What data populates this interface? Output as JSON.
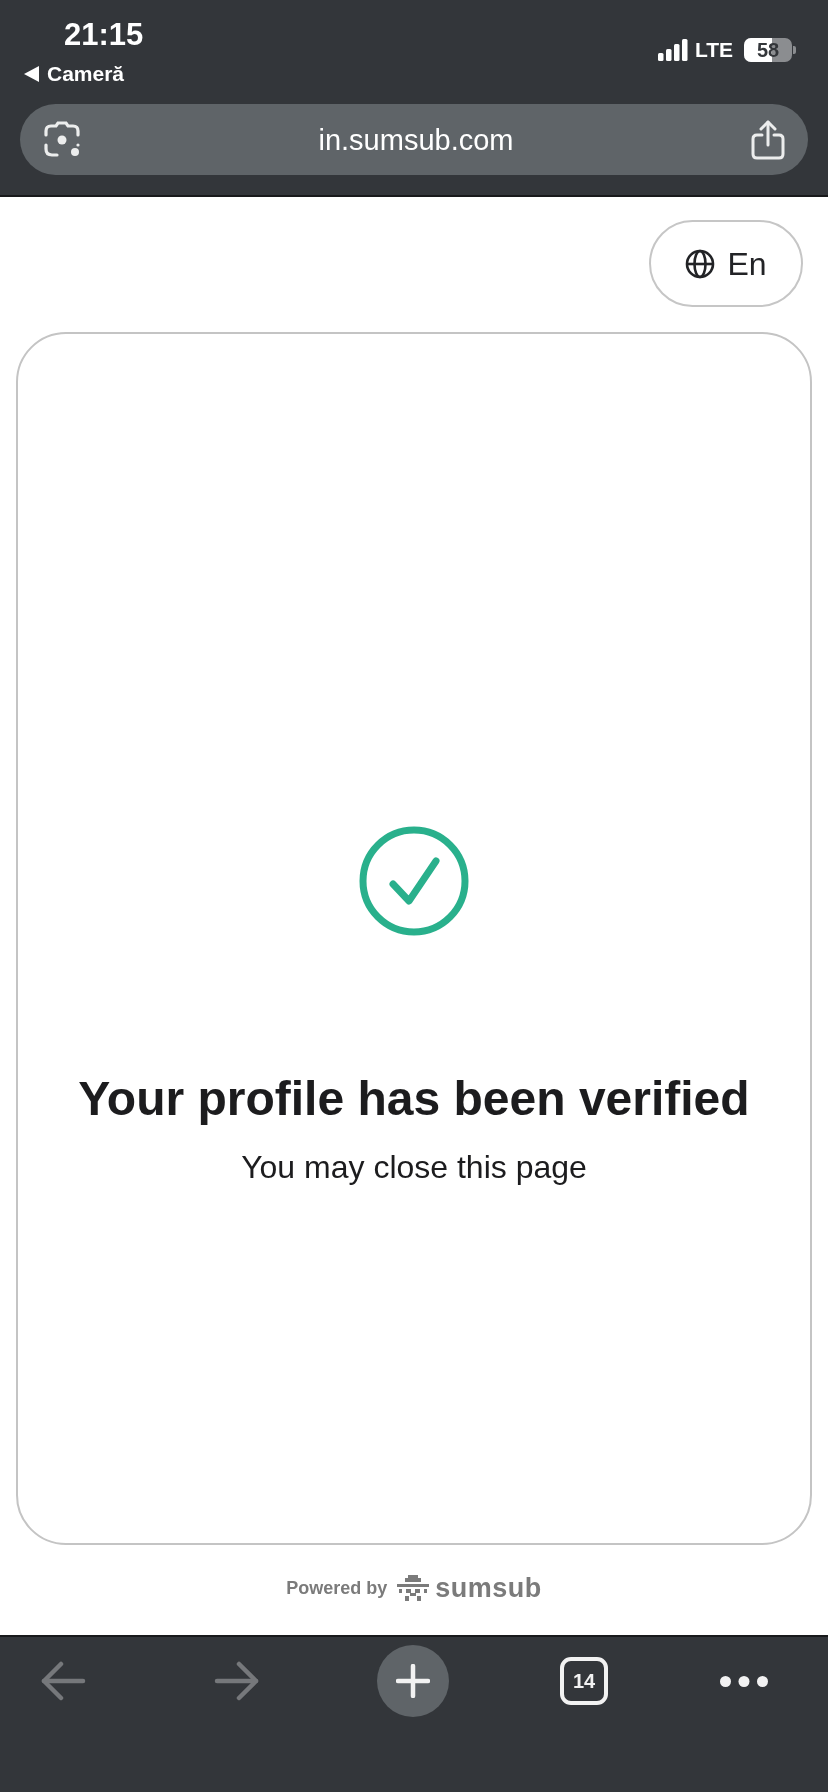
{
  "status_bar": {
    "time": "21:15",
    "back_app": "Cameră",
    "network": "LTE",
    "battery": "58"
  },
  "browser": {
    "url": "in.sumsub.com"
  },
  "language_button": {
    "label": "En"
  },
  "result": {
    "title": "Your profile has been verified",
    "message": "You may close this page"
  },
  "footer": {
    "powered_by": "Powered by",
    "brand": "sumsub"
  },
  "toolbar": {
    "back_disabled": true,
    "forward_disabled": true,
    "tab_count": "14"
  }
}
